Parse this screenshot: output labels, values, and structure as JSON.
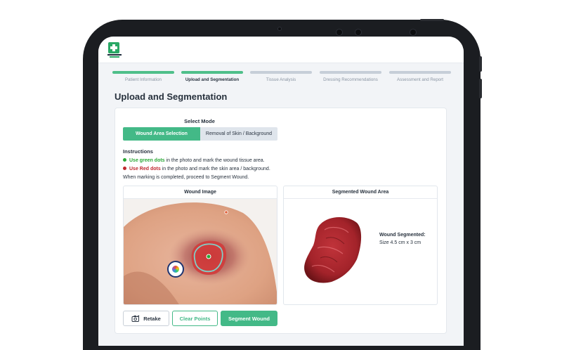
{
  "steps": [
    {
      "label": "Patient Information",
      "state": "done"
    },
    {
      "label": "Upload and Segmentation",
      "state": "active"
    },
    {
      "label": "Tissue Analysis",
      "state": "pending"
    },
    {
      "label": "Dressing Recommendations",
      "state": "pending"
    },
    {
      "label": "Assessment and Report",
      "state": "pending"
    }
  ],
  "page_title": "Upload and Segmentation",
  "mode": {
    "title": "Select Mode",
    "options": [
      "Wound Area Selection",
      "Removal of Skin / Background"
    ],
    "selected": "Wound Area Selection"
  },
  "instructions": {
    "title": "Instructions",
    "green_strong": "Use green dots",
    "green_rest": " in the photo and mark the wound tissue area.",
    "red_strong": "Use Red dots",
    "red_rest": " in the photo and mark the skin area / background.",
    "final": "When marking is completed, proceed to Segment Wound."
  },
  "wound_panel": {
    "title": "Wound Image"
  },
  "segmented_panel": {
    "title": "Segmented Wound Area",
    "status": "Wound Segmented:",
    "size": "Size 4.5 cm x 3 cm"
  },
  "buttons": {
    "retake": "Retake",
    "clear": "Clear Points",
    "segment": "Segment Wound"
  },
  "colors": {
    "accent": "#43b987",
    "green_dot": "#2aa836",
    "red_dot": "#c0262d"
  }
}
